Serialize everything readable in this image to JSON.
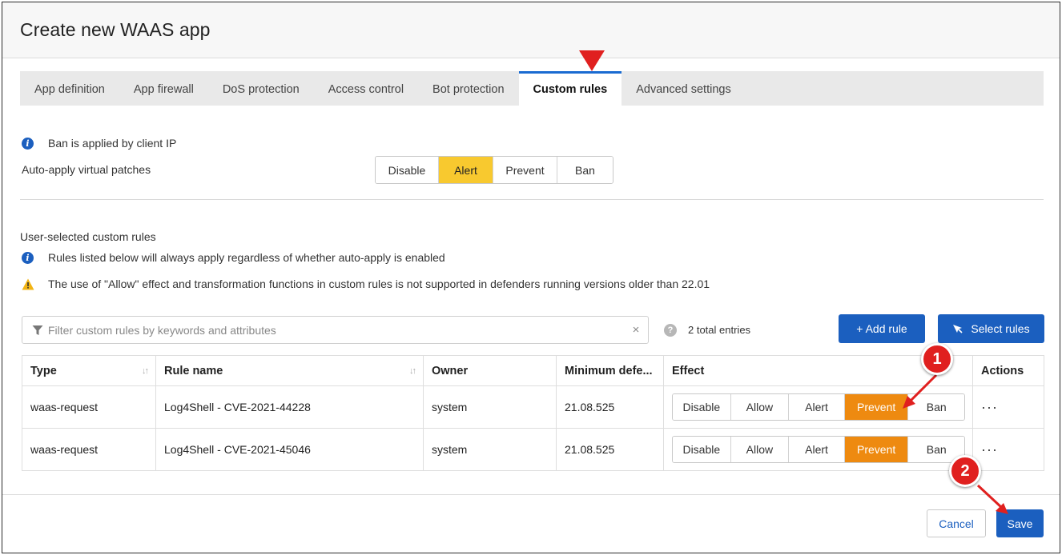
{
  "header": {
    "title": "Create new WAAS app"
  },
  "tabs": [
    {
      "label": "App definition"
    },
    {
      "label": "App firewall"
    },
    {
      "label": "DoS protection"
    },
    {
      "label": "Access control"
    },
    {
      "label": "Bot protection"
    },
    {
      "label": "Custom rules"
    },
    {
      "label": "Advanced settings"
    }
  ],
  "active_tab": "Custom rules",
  "auto_apply": {
    "info": "Ban is applied by client IP",
    "label": "Auto-apply virtual patches",
    "options": [
      "Disable",
      "Alert",
      "Prevent",
      "Ban"
    ],
    "selected": "Alert"
  },
  "user_rules": {
    "heading": "User-selected custom rules",
    "info": "Rules listed below will always apply regardless of whether auto-apply is enabled",
    "warning": "The use of \"Allow\" effect and transformation functions in custom rules is not supported in defenders running versions older than 22.01"
  },
  "toolbar": {
    "filter_placeholder": "Filter custom rules by keywords and attributes",
    "clear": "×",
    "help": "?",
    "total": "2 total entries",
    "add_rule": "+ Add rule",
    "select_rules": "Select rules"
  },
  "table": {
    "columns": [
      "Type",
      "Rule name",
      "Owner",
      "Minimum defe...",
      "Effect",
      "Actions"
    ],
    "effect_options": [
      "Disable",
      "Allow",
      "Alert",
      "Prevent",
      "Ban"
    ],
    "rows": [
      {
        "type": "waas-request",
        "rule_name": "Log4Shell - CVE-2021-44228",
        "owner": "system",
        "min_defender": "21.08.525",
        "effect": "Prevent",
        "actions": "···"
      },
      {
        "type": "waas-request",
        "rule_name": "Log4Shell - CVE-2021-45046",
        "owner": "system",
        "min_defender": "21.08.525",
        "effect": "Prevent",
        "actions": "···"
      }
    ]
  },
  "footer": {
    "cancel": "Cancel",
    "save": "Save"
  },
  "annotations": {
    "marker_1": "1",
    "marker_2": "2"
  },
  "colors": {
    "primary": "#1b5fbf",
    "alert_active": "#f8c92f",
    "prevent_active": "#ee8a10",
    "annotation_red": "#e0201f"
  }
}
